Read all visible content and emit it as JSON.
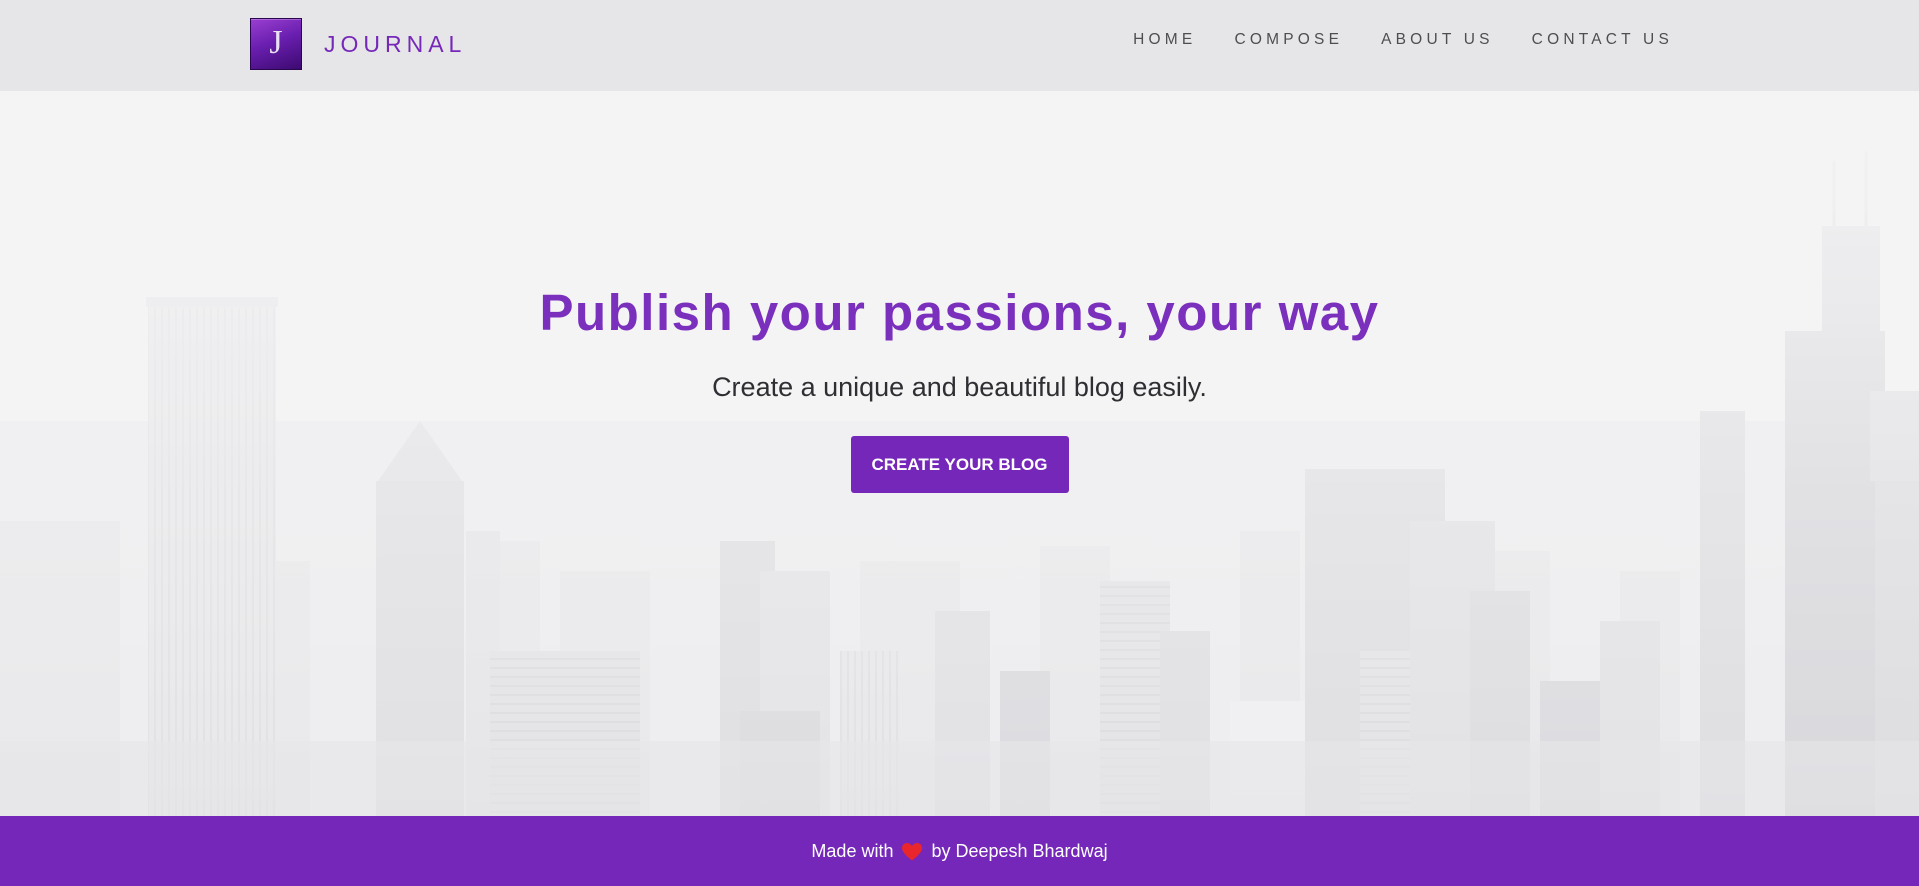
{
  "brand": {
    "logo_letter": "J",
    "name": "JOURNAL",
    "color": "#7628b8"
  },
  "nav": {
    "items": [
      {
        "label": "HOME"
      },
      {
        "label": "COMPOSE"
      },
      {
        "label": "ABOUT US"
      },
      {
        "label": "CONTACT US"
      }
    ]
  },
  "hero": {
    "title": "Publish your passions, your way",
    "subtitle": "Create a unique and beautiful blog easily.",
    "cta_label": "CREATE YOUR BLOG",
    "background": "city-skyline-image"
  },
  "footer": {
    "prefix": "Made with",
    "icon": "heart-icon",
    "suffix": "by Deepesh Bhardwaj"
  },
  "colors": {
    "accent": "#7427b8",
    "navbar_bg": "#e6e6e8",
    "hero_bg": "#f4f4f5",
    "heart": "#e8262c"
  }
}
